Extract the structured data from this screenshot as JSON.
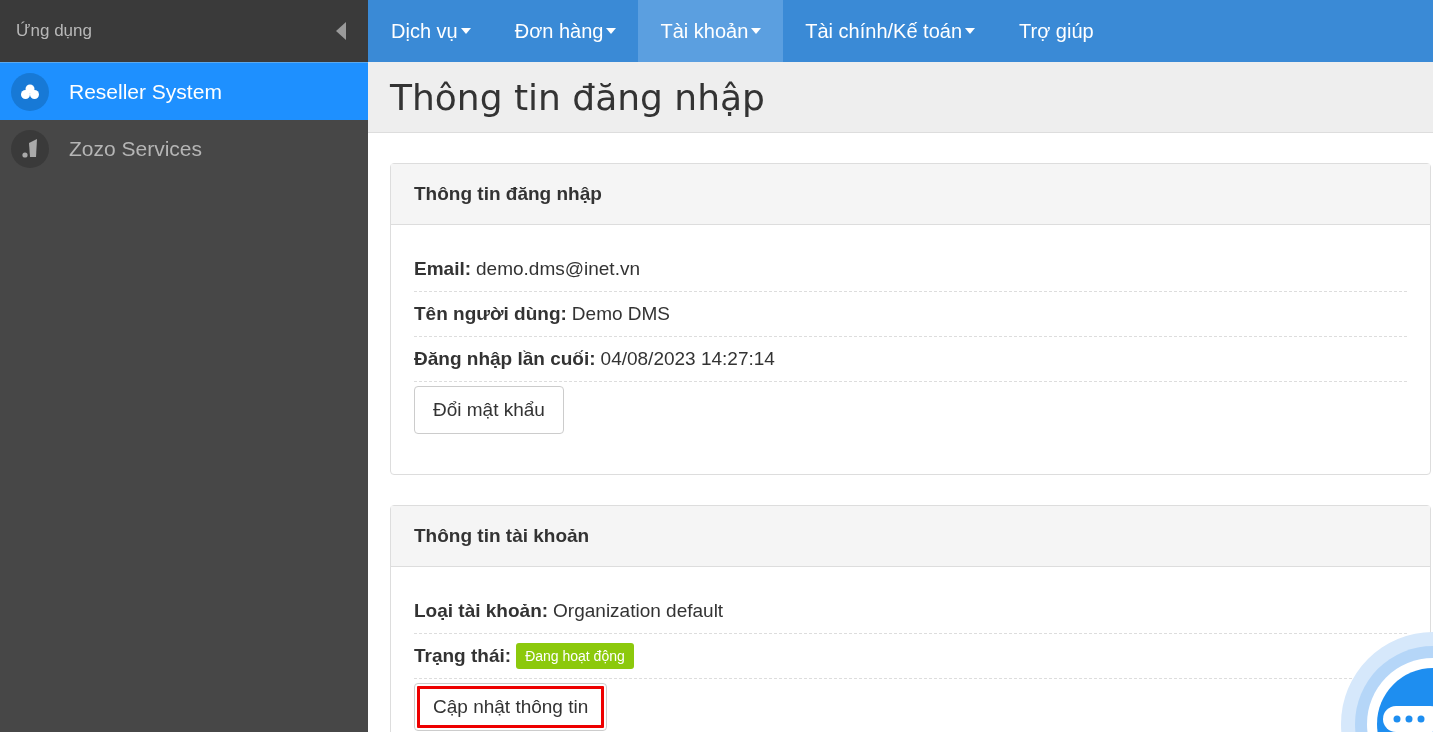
{
  "sidebar": {
    "title": "Ứng dụng",
    "items": [
      {
        "label": "Reseller System",
        "selected": true
      },
      {
        "label": "Zozo Services",
        "selected": false
      }
    ]
  },
  "nav": {
    "items": [
      {
        "label": "Dịch vụ",
        "selected": false,
        "dropdown": true
      },
      {
        "label": "Đơn hàng",
        "selected": false,
        "dropdown": true
      },
      {
        "label": "Tài khoản",
        "selected": true,
        "dropdown": true
      },
      {
        "label": "Tài chính/Kế toán",
        "selected": false,
        "dropdown": true
      },
      {
        "label": "Trợ giúp",
        "selected": false,
        "dropdown": false
      }
    ]
  },
  "page_title": "Thông tin đăng nhập",
  "panels": [
    {
      "title": "Thông tin đăng nhập",
      "rows": [
        {
          "kind": "text",
          "label": "Email:",
          "value": "demo.dms@inet.vn"
        },
        {
          "kind": "text",
          "label": "Tên người dùng:",
          "value": "Demo DMS"
        },
        {
          "kind": "text",
          "label": "Đăng nhập lần cuối:",
          "value": "04/08/2023 14:27:14"
        }
      ],
      "button": {
        "label": "Đổi mật khẩu",
        "highlighted": false
      }
    },
    {
      "title": "Thông tin tài khoản",
      "rows": [
        {
          "kind": "text",
          "label": "Loại tài khoản:",
          "value": "Organization default"
        },
        {
          "kind": "badge",
          "label": "Trạng thái:",
          "value": "Đang hoạt động"
        }
      ],
      "button": {
        "label": "Cập nhật thông tin",
        "highlighted": true
      }
    }
  ]
}
